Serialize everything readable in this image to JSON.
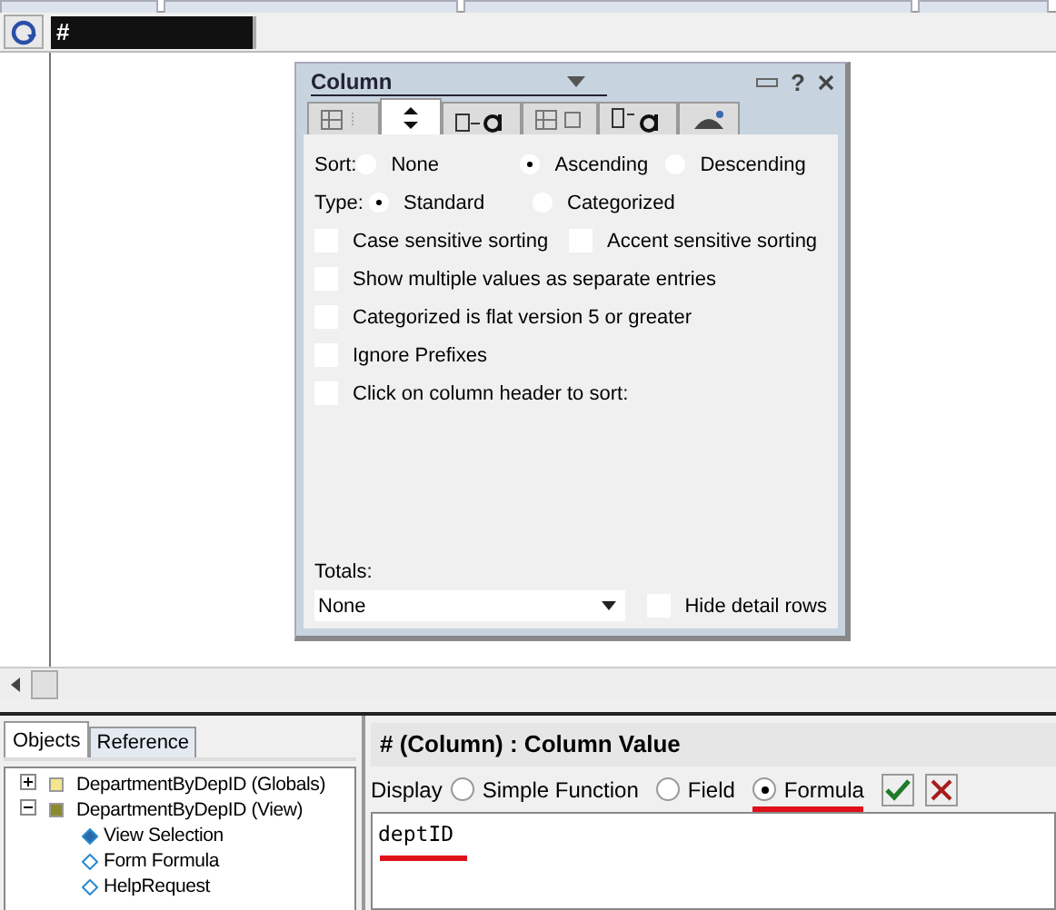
{
  "toolbar": {
    "field_value": "#"
  },
  "dialog": {
    "title": "Column",
    "help_glyph": "?",
    "tabs": [
      {
        "kind": "format",
        "selected": false
      },
      {
        "kind": "sort",
        "selected": true
      },
      {
        "kind": "title-font",
        "selected": false
      },
      {
        "kind": "width",
        "selected": false
      },
      {
        "kind": "header-font",
        "selected": false
      },
      {
        "kind": "advanced",
        "selected": false
      }
    ],
    "sort": {
      "label": "Sort:",
      "options": [
        {
          "label": "None",
          "selected": false
        },
        {
          "label": "Ascending",
          "selected": true
        },
        {
          "label": "Descending",
          "selected": false
        }
      ]
    },
    "type": {
      "label": "Type:",
      "options": [
        {
          "label": "Standard",
          "selected": true
        },
        {
          "label": "Categorized",
          "selected": false
        }
      ]
    },
    "option_rows": [
      [
        {
          "label": "Case sensitive sorting",
          "checked": false
        },
        {
          "label": "Accent sensitive sorting",
          "checked": false
        }
      ],
      [
        {
          "label": "Show multiple values as separate entries",
          "checked": false
        }
      ],
      [
        {
          "label": "Categorized is flat version 5 or greater",
          "checked": false
        }
      ],
      [
        {
          "label": "Ignore Prefixes",
          "checked": false
        }
      ],
      [
        {
          "label": "Click on column header to sort:",
          "checked": false
        }
      ]
    ],
    "totals": {
      "label": "Totals:",
      "value": "None"
    },
    "hide_detail": {
      "label": "Hide detail rows",
      "checked": false
    }
  },
  "objects_panel": {
    "tabs": [
      {
        "label": "Objects",
        "selected": true
      },
      {
        "label": "Reference",
        "selected": false
      }
    ],
    "tree": [
      {
        "label": "DepartmentByDepID (Globals)",
        "expanded": false,
        "color": "#f3e68a"
      },
      {
        "label": "DepartmentByDepID (View)",
        "expanded": true,
        "color": "#8c8a2e",
        "children": [
          {
            "label": "View Selection",
            "kind": "filled"
          },
          {
            "label": "Form Formula",
            "kind": "hollow"
          },
          {
            "label": "HelpRequest",
            "kind": "hollow"
          }
        ]
      }
    ]
  },
  "editor": {
    "title": "# (Column) : Column Value",
    "display_label": "Display",
    "modes": [
      {
        "label": "Simple Function",
        "selected": false,
        "underlined": false
      },
      {
        "label": "Field",
        "selected": false,
        "underlined": false
      },
      {
        "label": "Formula",
        "selected": true,
        "underlined": true
      }
    ],
    "formula": "deptID",
    "formula_underlined": true
  }
}
